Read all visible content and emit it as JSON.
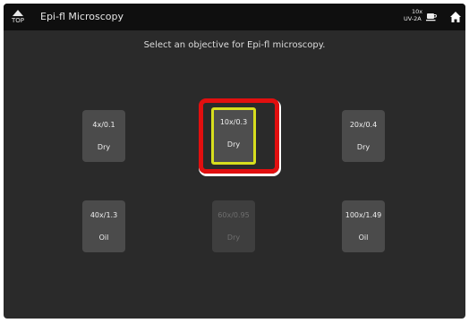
{
  "header": {
    "top_label": "TOP",
    "title": "Epi-fl Microscopy",
    "current_objective": "10x",
    "current_filter": "UV-2A",
    "icons": [
      "up-arrow-icon",
      "cup-icon",
      "home-icon"
    ]
  },
  "prompt": "Select an objective for Epi-fl microscopy.",
  "objectives": [
    {
      "spec": "4x/0.1",
      "medium": "Dry",
      "state": "enabled"
    },
    {
      "spec": "10x/0.3",
      "medium": "Dry",
      "state": "selected"
    },
    {
      "spec": "20x/0.4",
      "medium": "Dry",
      "state": "enabled"
    },
    {
      "spec": "40x/1.3",
      "medium": "Oil",
      "state": "enabled"
    },
    {
      "spec": "60x/0.95",
      "medium": "Dry",
      "state": "disabled"
    },
    {
      "spec": "100x/1.49",
      "medium": "Oil",
      "state": "enabled"
    }
  ],
  "colors": {
    "background": "#2a2a2a",
    "header": "#0f0f0f",
    "button": "#4b4b4b",
    "selected_border": "#d7de1e",
    "highlight": "#e20f0f",
    "disabled_text": "#6e6e6e"
  }
}
